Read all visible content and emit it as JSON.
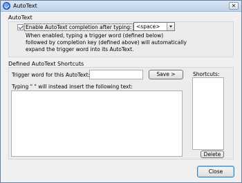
{
  "window": {
    "title": "AutoText",
    "close_glyph": "✕"
  },
  "autotext_section": {
    "label": "AutoText",
    "enable_checkbox": {
      "checked": true,
      "label": "Enable AutoText completion after typing:"
    },
    "completion_key": {
      "selected": "<space>"
    },
    "description_lines": [
      "When enabled, typing a trigger word (defined below)",
      "followed by completion key (defined above) will automatically",
      "expand the trigger word into its AutoText."
    ]
  },
  "shortcuts_section": {
    "label": "Defined AutoText Shortcuts",
    "trigger_label": "Trigger word for this AutoText:",
    "trigger_value": "",
    "save_label": "Save >",
    "insert_label": "Typing \" \" will instead insert the following text:",
    "insert_text": "",
    "shortcuts_label": "Shortcuts:",
    "delete_label": "Delete"
  },
  "footer": {
    "close_label": "Close"
  },
  "colors": {
    "titlebar": "#bfd3ea",
    "accent_border": "#3c7fb1"
  }
}
